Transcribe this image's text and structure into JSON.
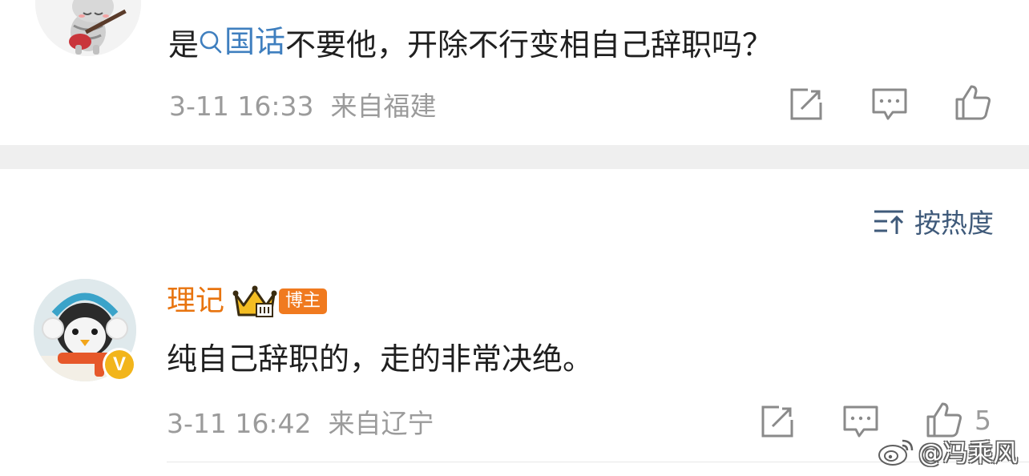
{
  "top_comment": {
    "text_prefix": "是",
    "topic": "国话",
    "text_suffix": "不要他，开除不行变相自己辞职吗？",
    "time": "3-11 16:33",
    "location": "来自福建"
  },
  "sort": {
    "label": "按热度"
  },
  "author_comment": {
    "name": "理记",
    "badge": "博主",
    "v_mark": "V",
    "text": "纯自己辞职的，走的非常决绝。",
    "time": "3-11 16:42",
    "location": "来自辽宁",
    "like_count": "5"
  },
  "watermark": {
    "text": "@冯乘风"
  },
  "colors": {
    "link": "#3f7fbf",
    "author_name": "#e8740f",
    "meta": "#9b9b9b",
    "band": "#efefef"
  },
  "icons": {
    "share": "share-icon",
    "comment": "comment-icon",
    "like": "thumb-up-icon",
    "sort": "sort-icon",
    "search": "search-icon",
    "crown": "crown-icon",
    "weibo": "weibo-logo-icon"
  }
}
